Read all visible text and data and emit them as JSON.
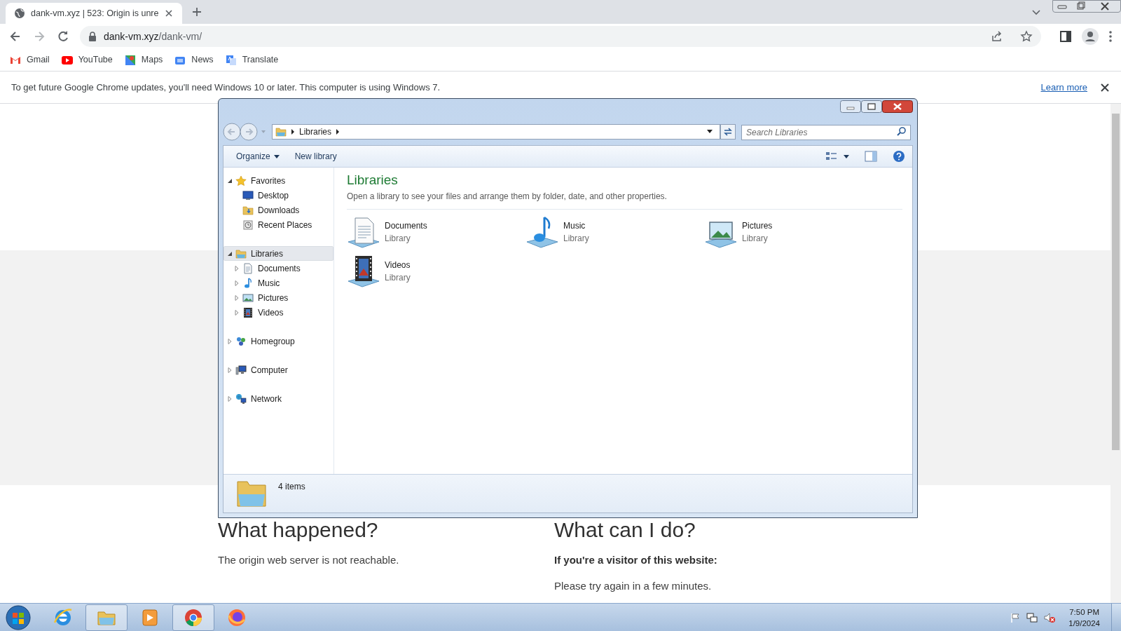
{
  "browser": {
    "tab": {
      "title": "dank-vm.xyz | 523: Origin is unre",
      "selected": true
    },
    "url_host": "dank-vm.xyz",
    "url_path": "/dank-vm/",
    "bookmarks": [
      {
        "label": "Gmail",
        "kind": "gmail"
      },
      {
        "label": "YouTube",
        "kind": "youtube"
      },
      {
        "label": "Maps",
        "kind": "maps"
      },
      {
        "label": "News",
        "kind": "news"
      },
      {
        "label": "Translate",
        "kind": "translate"
      }
    ],
    "infobar": {
      "message": "To get future Google Chrome updates, you'll need Windows 10 or later. This computer is using Windows 7.",
      "link": "Learn more"
    }
  },
  "page": {
    "sections": [
      {
        "heading": "What happened?",
        "body": "The origin web server is not reachable."
      },
      {
        "heading": "What can I do?",
        "subheading": "If you're a visitor of this website:",
        "body": "Please try again in a few minutes."
      }
    ]
  },
  "explorer": {
    "breadcrumb": [
      "Libraries"
    ],
    "search_placeholder": "Search Libraries",
    "toolbar": [
      {
        "label": "Organize",
        "dropdown": true
      },
      {
        "label": "New library",
        "dropdown": false
      }
    ],
    "nav": [
      {
        "label": "Favorites",
        "kind": "star",
        "expanded": true,
        "selected": false,
        "children": [
          {
            "label": "Desktop",
            "kind": "desktop",
            "selected": false
          },
          {
            "label": "Downloads",
            "kind": "downloads",
            "selected": false
          },
          {
            "label": "Recent Places",
            "kind": "recent",
            "selected": false
          }
        ]
      },
      {
        "label": "Libraries",
        "kind": "library",
        "expanded": true,
        "selected": true,
        "children": [
          {
            "label": "Documents",
            "kind": "documents",
            "expanded": false,
            "selected": false
          },
          {
            "label": "Music",
            "kind": "music",
            "expanded": false,
            "selected": false
          },
          {
            "label": "Pictures",
            "kind": "pictures",
            "expanded": false,
            "selected": false
          },
          {
            "label": "Videos",
            "kind": "videos",
            "expanded": false,
            "selected": false
          }
        ]
      },
      {
        "label": "Homegroup",
        "kind": "homegroup",
        "expanded": false,
        "selected": false
      },
      {
        "label": "Computer",
        "kind": "computer",
        "expanded": false,
        "selected": false
      },
      {
        "label": "Network",
        "kind": "network",
        "expanded": false,
        "selected": false
      }
    ],
    "content": {
      "title": "Libraries",
      "description": "Open a library to see your files and arrange them by folder, date, and other properties.",
      "items": [
        {
          "name": "Documents",
          "type": "Library",
          "kind": "documents"
        },
        {
          "name": "Music",
          "type": "Library",
          "kind": "music"
        },
        {
          "name": "Pictures",
          "type": "Library",
          "kind": "pictures"
        },
        {
          "name": "Videos",
          "type": "Library",
          "kind": "videos"
        }
      ]
    },
    "status": "4 items"
  },
  "taskbar": {
    "apps": [
      {
        "kind": "ie",
        "active": false
      },
      {
        "kind": "explorer",
        "active": true
      },
      {
        "kind": "media",
        "active": false
      },
      {
        "kind": "chrome",
        "active": true
      },
      {
        "kind": "firefox",
        "active": false
      }
    ],
    "time": "7:50 PM",
    "date": "1/9/2024"
  }
}
